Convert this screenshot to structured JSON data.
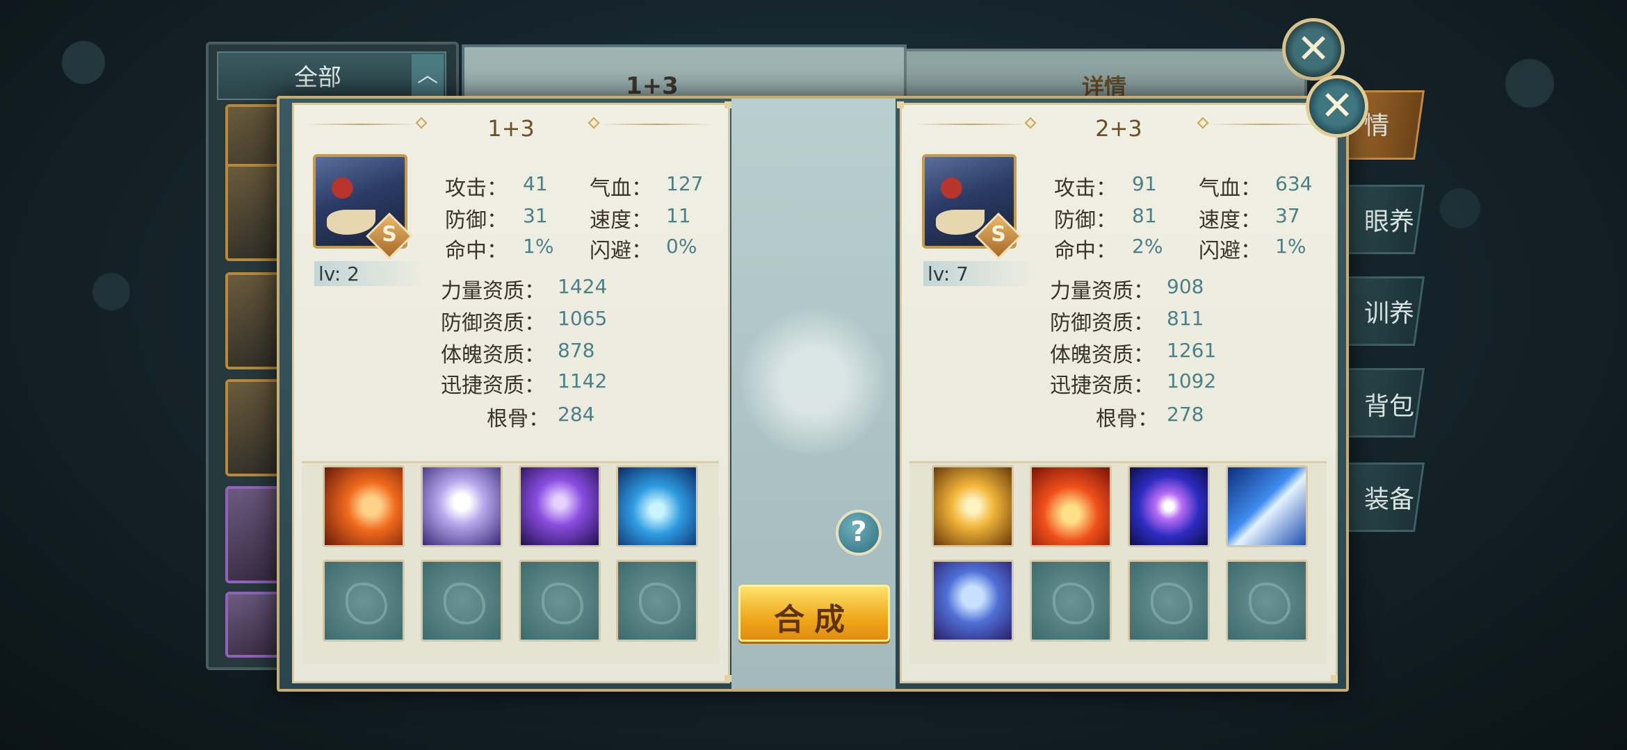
{
  "background": {
    "filter_label": "全部",
    "filter_arrow": "︿",
    "middle_title": "1+3",
    "detail_title": "详情",
    "tabs": [
      "情",
      "眼养",
      "训养",
      "背包",
      "装备"
    ]
  },
  "popup": {
    "close_glyph": "✕",
    "help_glyph": "?",
    "compose_label": "合成",
    "pets": [
      {
        "title": "1+3",
        "grade": "S",
        "level": "lv: 2",
        "stats": {
          "attack": {
            "label": "攻击：",
            "value": "41"
          },
          "hp": {
            "label": "气血：",
            "value": "127"
          },
          "defense": {
            "label": "防御：",
            "value": "31"
          },
          "speed": {
            "label": "速度：",
            "value": "11"
          },
          "hit": {
            "label": "命中：",
            "value": "1%"
          },
          "dodge": {
            "label": "闪避：",
            "value": "0%"
          }
        },
        "aptitudes": [
          {
            "label": "力量资质：",
            "value": "1424"
          },
          {
            "label": "防御资质：",
            "value": "1065"
          },
          {
            "label": "体魄资质：",
            "value": "878"
          },
          {
            "label": "迅捷资质：",
            "value": "1142"
          },
          {
            "label": "根骨：",
            "value": "284"
          }
        ],
        "skills": [
          "phoenix-fire-skill-icon",
          "wind-orb-skill-icon",
          "purple-vortex-skill-icon",
          "blue-chain-skill-icon",
          "empty",
          "empty",
          "empty",
          "empty"
        ]
      },
      {
        "title": "2+3",
        "grade": "S",
        "level": "lv: 7",
        "stats": {
          "attack": {
            "label": "攻击：",
            "value": "91"
          },
          "hp": {
            "label": "气血：",
            "value": "634"
          },
          "defense": {
            "label": "防御：",
            "value": "81"
          },
          "speed": {
            "label": "速度：",
            "value": "37"
          },
          "hit": {
            "label": "命中：",
            "value": "2%"
          },
          "dodge": {
            "label": "闪避：",
            "value": "1%"
          }
        },
        "aptitudes": [
          {
            "label": "力量资质：",
            "value": "908"
          },
          {
            "label": "防御资质：",
            "value": "811"
          },
          {
            "label": "体魄资质：",
            "value": "1261"
          },
          {
            "label": "迅捷资质：",
            "value": "1092"
          },
          {
            "label": "根骨：",
            "value": "278"
          }
        ],
        "skills": [
          "golden-shield-skill-icon",
          "flame-skill-icon",
          "void-orb-skill-icon",
          "lightning-skill-icon",
          "guard-shield-skill-icon",
          "empty",
          "empty",
          "empty"
        ]
      }
    ]
  },
  "colors": {
    "panel_bg": "#f0efe3",
    "stat_value": "#4c7f86",
    "gold_border": "#c8ad6d",
    "compose_button": "#f0a81c"
  }
}
